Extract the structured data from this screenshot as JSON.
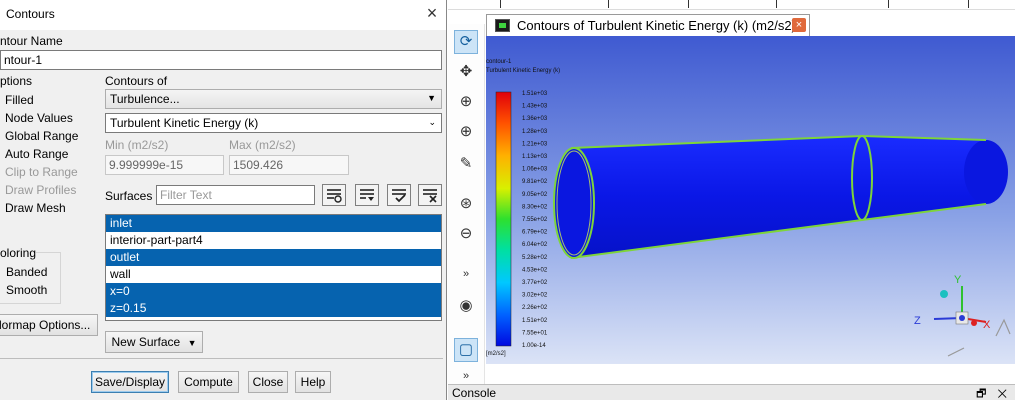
{
  "dialog": {
    "title": "Contours",
    "close_label": "×",
    "contour_name_label": "ntour Name",
    "contour_name_value": "ntour-1",
    "options_label": "ptions",
    "options": [
      "Filled",
      "Node Values",
      "Global Range",
      "Auto Range",
      "Clip to Range",
      "Draw Profiles",
      "Draw Mesh"
    ],
    "coloring_label": "oloring",
    "coloring_options": [
      "Banded",
      "Smooth"
    ],
    "colormap_button": "lormap Options...",
    "contours_of_label": "Contours of",
    "contours_of_category": "Turbulence...",
    "contours_of_variable": "Turbulent Kinetic Energy (k)",
    "min_label": "Min (m2/s2)",
    "max_label": "Max (m2/s2)",
    "min_value": "9.999999e-15",
    "max_value": "1509.426",
    "surfaces_label": "Surfaces",
    "filter_placeholder": "Filter Text",
    "surfaces": [
      {
        "name": "inlet",
        "selected": true
      },
      {
        "name": "interior-part-part4",
        "selected": false
      },
      {
        "name": "outlet",
        "selected": true
      },
      {
        "name": "wall",
        "selected": false
      },
      {
        "name": "x=0",
        "selected": true
      },
      {
        "name": "z=0.15",
        "selected": true
      }
    ],
    "new_surface_button": "New Surface",
    "buttons": {
      "save_display": "Save/Display",
      "compute": "Compute",
      "close": "Close",
      "help": "Help"
    }
  },
  "graphics": {
    "tab_title": "Contours of Turbulent Kinetic Energy (k) (m2/s2)",
    "tab_close": "×",
    "header_line1": "contour-1",
    "header_line2": "Turbulent Kinetic Energy (k)",
    "colorbar_labels": [
      "1.51e+03",
      "1.43e+03",
      "1.36e+03",
      "1.28e+03",
      "1.21e+03",
      "1.13e+03",
      "1.06e+03",
      "9.81e+02",
      "9.05e+02",
      "8.30e+02",
      "7.55e+02",
      "6.79e+02",
      "6.04e+02",
      "5.28e+02",
      "4.53e+02",
      "3.77e+02",
      "3.02e+02",
      "2.26e+02",
      "1.51e+02",
      "7.55e+01",
      "1.00e-14"
    ],
    "colorbar_unit": "[m2/s2]",
    "axes": {
      "x": "X",
      "y": "Y",
      "z": "Z"
    },
    "console_label": "Console",
    "console_icons": "🗗 ✕"
  },
  "colors": {
    "selection": "#0663af",
    "pipe": "#0a17e0",
    "pipe_edge": "#7ed43a"
  },
  "icons": {
    "toolbar": [
      "rotate-icon",
      "pan-icon",
      "zoom-in-icon",
      "zoom-box-icon",
      "probe-icon",
      "zoom-fit-icon",
      "zoom-out-icon",
      "more-icon",
      "view-icon",
      "layout-icon",
      "more-icon"
    ]
  }
}
